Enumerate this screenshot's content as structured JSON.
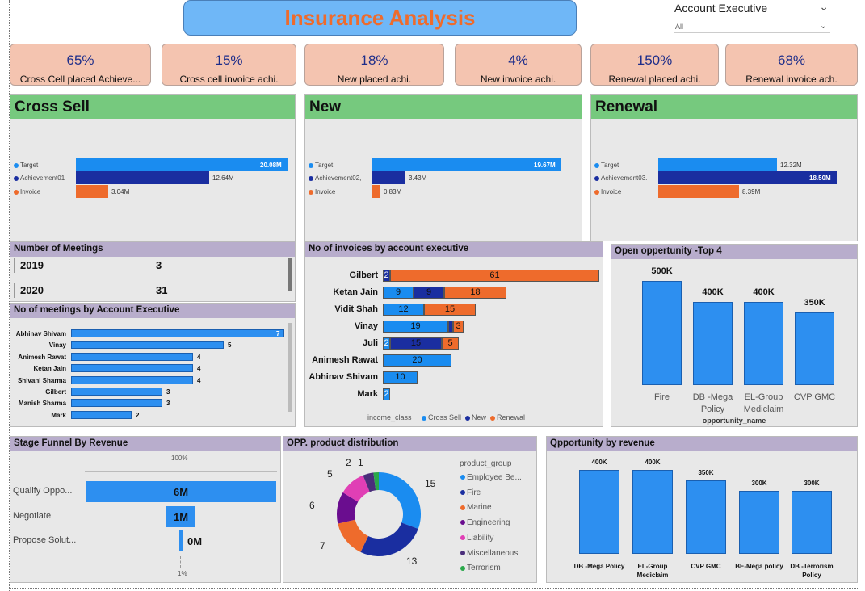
{
  "header": {
    "title": "Insurance Analysis"
  },
  "slicer": {
    "label": "Account Executive",
    "value": "All"
  },
  "kpis": [
    {
      "value": "65%",
      "label": "Cross Cell placed Achieve..."
    },
    {
      "value": "15%",
      "label": "Cross  cell invoice achi."
    },
    {
      "value": "18%",
      "label": "New placed achi."
    },
    {
      "value": "4%",
      "label": "New invoice achi."
    },
    {
      "value": "150%",
      "label": "Renewal placed achi."
    },
    {
      "value": "68%",
      "label": "Renewal invoice ach."
    }
  ],
  "colors": {
    "target": "#1a8cf0",
    "achievement": "#1a2ea0",
    "invoice": "#ee6b2c",
    "header_green": "#76c97e",
    "header_purple": "#b8adcc",
    "kpi_bg": "#f4c4b0",
    "bar_blue": "#2d8ff0"
  },
  "cross_sell": {
    "title": "Cross Sell",
    "rows": [
      {
        "label": "Target",
        "value": "20.08M",
        "amount": 20.08
      },
      {
        "label": "Achievement01",
        "value": "12.64M",
        "amount": 12.64
      },
      {
        "label": "Invoice",
        "value": "3.04M",
        "amount": 3.04
      }
    ]
  },
  "new": {
    "title": "New",
    "rows": [
      {
        "label": "Target",
        "value": "19.67M",
        "amount": 19.67
      },
      {
        "label": "Achievement02,",
        "value": "3.43M",
        "amount": 3.43
      },
      {
        "label": "Invoice",
        "value": "0.83M",
        "amount": 0.83
      }
    ]
  },
  "renewal": {
    "title": "Renewal",
    "rows": [
      {
        "label": "Target",
        "value": "12.32M",
        "amount": 12.32
      },
      {
        "label": "Achievement03.",
        "value": "18.50M",
        "amount": 18.5
      },
      {
        "label": "Invoice",
        "value": "8.39M",
        "amount": 8.39
      }
    ]
  },
  "meetings": {
    "title": "Number of Meetings",
    "rows": [
      {
        "year": "2019",
        "count": "3"
      },
      {
        "year": "2020",
        "count": "31"
      }
    ]
  },
  "meetings_by_ae": {
    "title": "No of meetings by Account Executive",
    "chart_data": {
      "type": "bar",
      "orientation": "horizontal",
      "categories": [
        "Abhinav Shivam",
        "Vinay",
        "Animesh Rawat",
        "Ketan Jain",
        "Shivani Sharma",
        "Gilbert",
        "Manish Sharma",
        "Mark"
      ],
      "values": [
        7,
        5,
        4,
        4,
        4,
        3,
        3,
        2
      ],
      "xlim": [
        0,
        7
      ]
    }
  },
  "invoices_by_ae": {
    "title": "No of invoices by account executive",
    "legend_title": "income_class",
    "legend": [
      "Cross Sell",
      "New",
      "Renewal"
    ],
    "chart_data": {
      "type": "bar",
      "stacked": true,
      "orientation": "horizontal",
      "categories": [
        "Gilbert",
        "Ketan Jain",
        "Vidit Shah",
        "Vinay",
        "Juli",
        "Animesh Rawat",
        "Abhinav Shivam",
        "Mark"
      ],
      "series": [
        {
          "name": "Cross Sell",
          "values": [
            0,
            9,
            12,
            19,
            2,
            20,
            10,
            2
          ]
        },
        {
          "name": "New",
          "values": [
            2,
            9,
            0,
            1,
            15,
            0,
            0,
            0
          ]
        },
        {
          "name": "Renewal",
          "values": [
            61,
            18,
            15,
            3,
            5,
            0,
            0,
            0
          ]
        }
      ],
      "labels": [
        [
          "",
          "2",
          "61"
        ],
        [
          "9",
          "9",
          "18"
        ],
        [
          "12",
          "",
          "15"
        ],
        [
          "19",
          "",
          "3"
        ],
        [
          "2",
          "15",
          "5"
        ],
        [
          "20",
          "",
          ""
        ],
        [
          "10",
          "",
          ""
        ],
        [
          "2",
          "",
          ""
        ]
      ]
    }
  },
  "open_opp": {
    "title": "Open oppertunity -Top 4",
    "xlabel": "opportunity_name",
    "chart_data": {
      "type": "bar",
      "categories": [
        "Fire",
        "DB -Mega Policy",
        "EL-Group Mediclaim",
        "CVP GMC"
      ],
      "values": [
        500,
        400,
        400,
        350
      ],
      "labels": [
        "500K",
        "400K",
        "400K",
        "350K"
      ],
      "ylim": [
        0,
        500
      ]
    }
  },
  "funnel": {
    "title": "Stage Funnel By Revenue",
    "top_label": "100%",
    "bottom_label": "1%",
    "chart_data": {
      "type": "bar",
      "orientation": "funnel",
      "categories": [
        "Qualify Oppo...",
        "Negotiate",
        "Propose Solut..."
      ],
      "values": [
        6,
        1,
        0.05
      ],
      "labels": [
        "6M",
        "1M",
        "0M"
      ]
    }
  },
  "product_dist": {
    "title": "OPP. product distribution",
    "legend_title": "product_group",
    "chart_data": {
      "type": "pie",
      "donut": true,
      "categories": [
        "Employee Be...",
        "Fire",
        "Marine",
        "Engineering",
        "Liability",
        "Miscellaneous",
        "Terrorism"
      ],
      "values": [
        15,
        13,
        7,
        6,
        5,
        2,
        1
      ],
      "colors": [
        "#1a8cf0",
        "#1a2ea0",
        "#ee6b2c",
        "#6a0d8f",
        "#e03fb5",
        "#4a2d7a",
        "#2aa84a"
      ]
    }
  },
  "opp_by_revenue": {
    "title": "Qpportunity by revenue",
    "chart_data": {
      "type": "bar",
      "categories": [
        "DB -Mega Policy",
        "EL-Group Mediclaim",
        "CVP GMC",
        "BE-Mega policy",
        "DB -Terrorism Policy"
      ],
      "values": [
        400,
        400,
        350,
        300,
        300
      ],
      "labels": [
        "400K",
        "400K",
        "350K",
        "300K",
        "300K"
      ],
      "ylim": [
        0,
        400
      ]
    }
  }
}
